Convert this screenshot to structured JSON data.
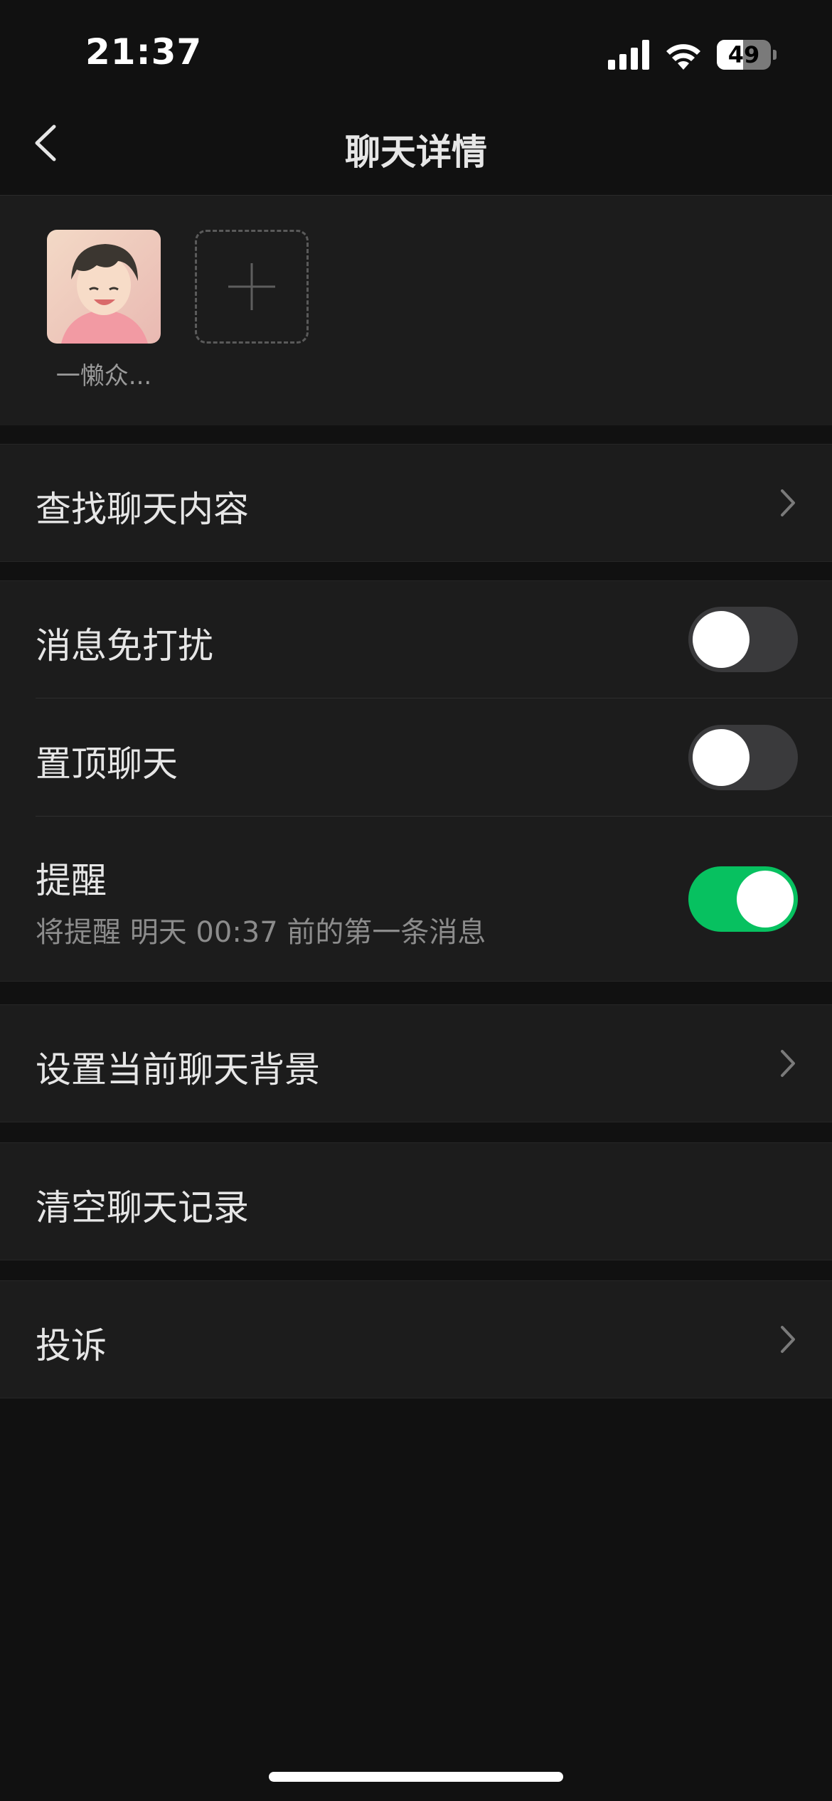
{
  "status_bar": {
    "time": "21:37",
    "battery_level": 49,
    "battery_text": "49",
    "icons": [
      "signal-icon",
      "wifi-icon",
      "battery-icon"
    ]
  },
  "nav": {
    "title": "聊天详情",
    "back_icon": "chevron-left-icon"
  },
  "members": [
    {
      "name": "一懒众..."
    }
  ],
  "add_member_icon": "plus-icon",
  "settings": {
    "search_chat": "查找聊天内容",
    "mute": {
      "label": "消息免打扰",
      "on": false
    },
    "pin": {
      "label": "置顶聊天",
      "on": false
    },
    "reminder": {
      "label": "提醒",
      "sub": "将提醒 明天 00:37 前的第一条消息",
      "on": true
    },
    "background": "设置当前聊天背景",
    "clear_history": "清空聊天记录",
    "report": "投诉"
  },
  "colors": {
    "background": "#111111",
    "cell": "#1c1c1c",
    "toggle_on": "#07c160",
    "toggle_off": "#3a3a3c"
  }
}
